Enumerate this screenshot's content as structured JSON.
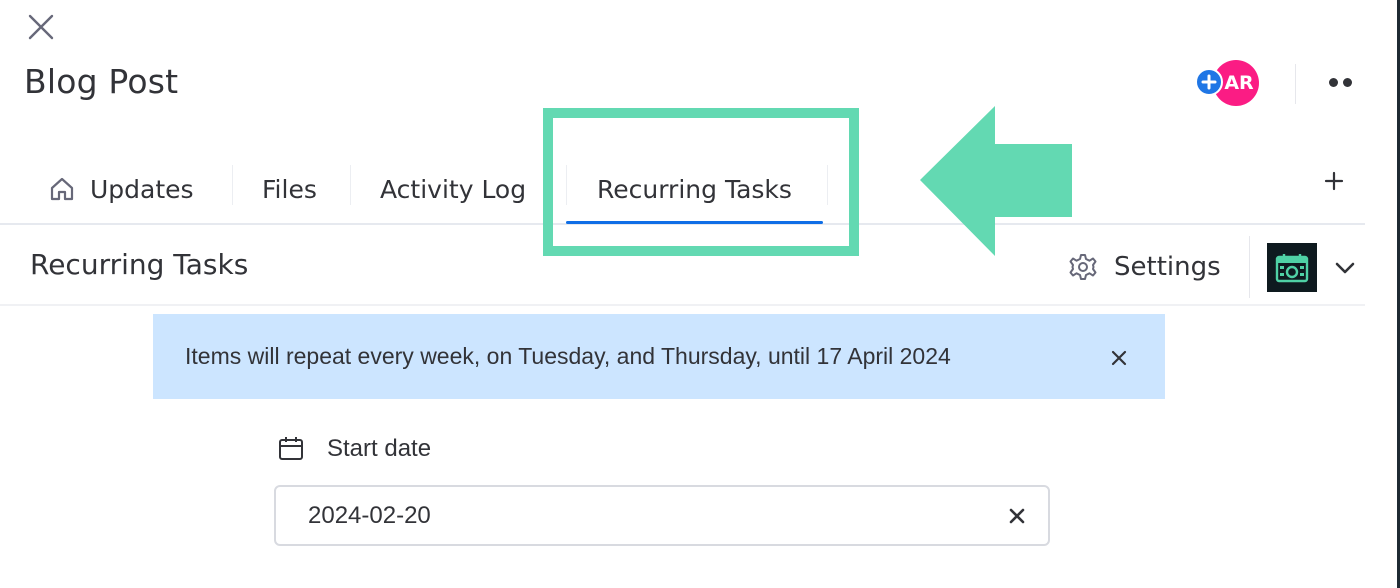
{
  "window": {
    "title": "Blog Post",
    "close_icon": "close-icon",
    "more_icon": "more-horizontal-icon"
  },
  "header": {
    "avatar_initials": "AR",
    "avatar_color": "#fb1c84",
    "add_person_color": "#1f76e5"
  },
  "tabs": [
    {
      "label": "Updates",
      "icon": "home-icon",
      "active": false
    },
    {
      "label": "Files",
      "active": false
    },
    {
      "label": "Activity Log",
      "active": false
    },
    {
      "label": "Recurring Tasks",
      "active": true
    }
  ],
  "add_tab_icon": "plus-icon",
  "annotation": {
    "highlight_color": "#63d9b2",
    "target": "Recurring Tasks"
  },
  "subheader": {
    "title": "Recurring Tasks",
    "settings_label": "Settings",
    "settings_icon": "gear-icon",
    "app_icon": "calendar-app-icon",
    "dropdown_icon": "chevron-down-icon"
  },
  "banner": {
    "text": "Items will repeat every week, on Tuesday, and Thursday, until 17 April 2024",
    "background": "#cce5ff"
  },
  "start_date": {
    "label": "Start date",
    "icon": "calendar-icon",
    "value": "2024-02-20"
  },
  "colors": {
    "accent_tab_underline": "#0f6ee6",
    "text": "#323338"
  }
}
